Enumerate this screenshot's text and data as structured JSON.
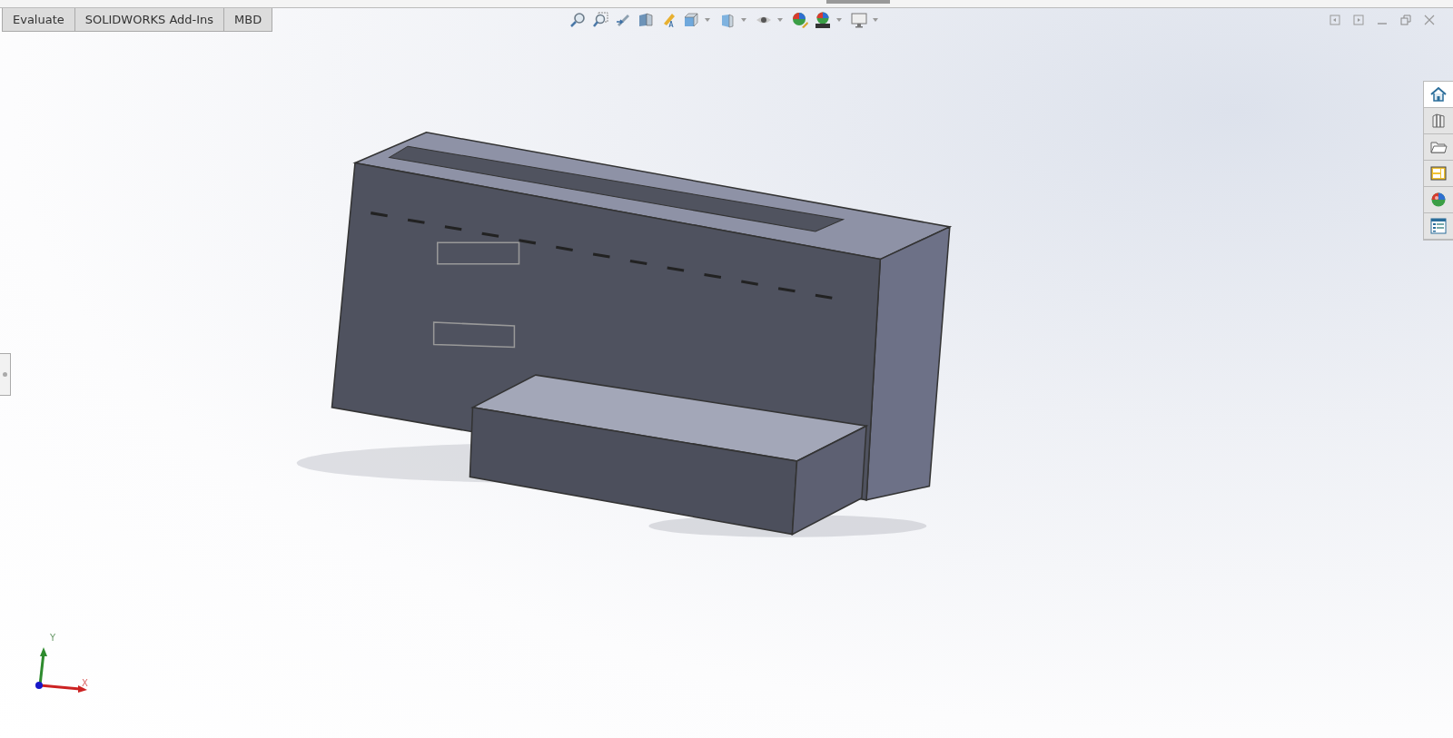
{
  "tabs": [
    {
      "label": "Evaluate"
    },
    {
      "label": "SOLIDWORKS Add-Ins"
    },
    {
      "label": "MBD"
    }
  ],
  "task_pane": [
    {
      "kind": "home",
      "selected": true
    },
    {
      "kind": "library",
      "selected": false
    },
    {
      "kind": "explorer",
      "selected": false
    },
    {
      "kind": "palette",
      "selected": false
    },
    {
      "kind": "appearance",
      "selected": false
    },
    {
      "kind": "properties",
      "selected": false
    }
  ],
  "triad": {
    "y_label": "Y",
    "x_label": "X"
  }
}
